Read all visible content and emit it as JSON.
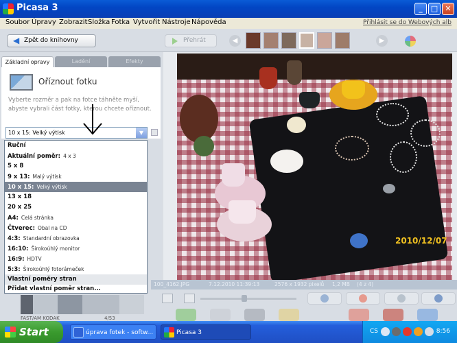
{
  "window": {
    "title": "Picasa 3",
    "minimize": "_",
    "maximize": "□",
    "close": "✕"
  },
  "menu": {
    "items": [
      "Soubor",
      "Úpravy",
      "Zobrazit",
      "Složka",
      "Fotka",
      "Vytvořit",
      "Nástroje",
      "Nápověda"
    ],
    "signin": "Přihlásit se do Webových alb"
  },
  "toolbar": {
    "back_label": "Zpět do knihovny",
    "play_label": "Přehrát"
  },
  "tabs": [
    {
      "label": "Základní opravy",
      "active": true
    },
    {
      "label": "Ladění",
      "active": false
    },
    {
      "label": "Efekty",
      "active": false
    }
  ],
  "crop": {
    "title": "Oříznout fotku",
    "description": "Vyberte rozměr a pak na fotce táhněte myší, abyste vybrali část fotky, kterou chcete oříznout.",
    "selected_value": "10 x 15: Velký výtisk"
  },
  "ratio_options": [
    {
      "main": "Ruční",
      "sub": ""
    },
    {
      "main": "Aktuální poměr:",
      "sub": "4 x 3"
    },
    {
      "main": "5 x 8",
      "sub": ""
    },
    {
      "main": "9 x 13:",
      "sub": "Malý výtisk"
    },
    {
      "main": "10 x 15:",
      "sub": "Velký výtisk"
    },
    {
      "main": "13 x 18",
      "sub": ""
    },
    {
      "main": "20 x 25",
      "sub": ""
    },
    {
      "main": "A4:",
      "sub": "Celá stránka"
    },
    {
      "main": "Čtverec:",
      "sub": "Obal na CD"
    },
    {
      "main": "4:3:",
      "sub": "Standardní obrazovka"
    },
    {
      "main": "16:10:",
      "sub": "Širokoúhlý monitor"
    },
    {
      "main": "16:9:",
      "sub": "HDTV"
    },
    {
      "main": "5:3:",
      "sub": "Širokoúhlý fotorámeček"
    },
    {
      "main": "Vlastní poměry stran",
      "sub": ""
    },
    {
      "main": "Přidat vlastní poměr stran...",
      "sub": ""
    }
  ],
  "selected_option_index": 4,
  "photo": {
    "date_stamp": "2010/12/07"
  },
  "info": {
    "filename": "100_4162.JPG",
    "datetime": "7.12.2010 11:39:13",
    "dimensions": "2576 x 1932 pixelů",
    "size": "1,2 MB",
    "position": "(4 z 4)"
  },
  "histogram": {
    "label": "FAST/AM KODAK",
    "percent": "4/53"
  },
  "taskbar": {
    "start_label": "Start",
    "tasks": [
      "úprava fotek - softw...",
      "Picasa 3"
    ],
    "lang": "CS",
    "clock": "8:56"
  },
  "colors": {
    "accent": "#245edb",
    "selection": "#7a8493",
    "date_stamp": "#f0c020"
  }
}
